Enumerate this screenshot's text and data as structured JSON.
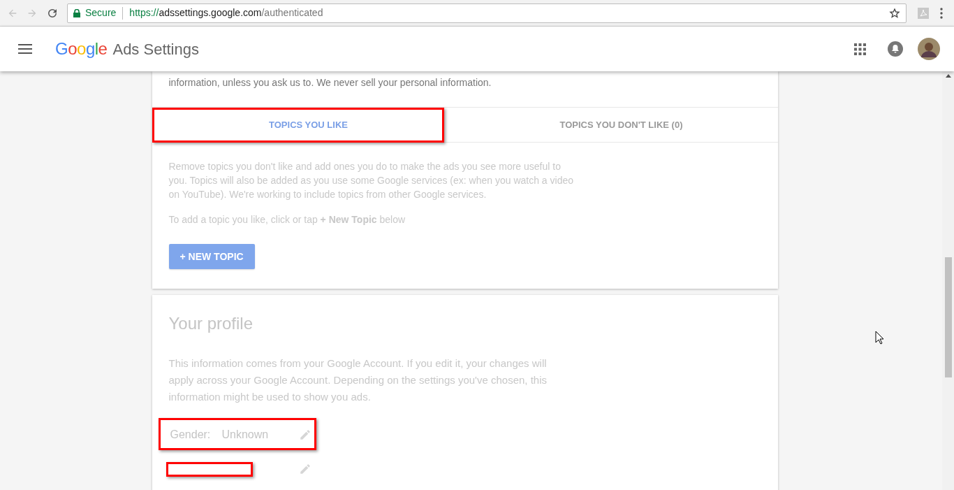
{
  "browser": {
    "secure_label": "Secure",
    "url_scheme": "https://",
    "url_host": "adssettings.google.com",
    "url_path": "/authenticated"
  },
  "header": {
    "logo_letters": [
      {
        "letter": "G",
        "color": "#4285f4"
      },
      {
        "letter": "o",
        "color": "#ea4335"
      },
      {
        "letter": "o",
        "color": "#fbbc05"
      },
      {
        "letter": "g",
        "color": "#4285f4"
      },
      {
        "letter": "l",
        "color": "#34a853"
      },
      {
        "letter": "e",
        "color": "#ea4335"
      }
    ],
    "title": "Ads Settings"
  },
  "intro_text": "information, unless you ask us to. We never sell your personal information.",
  "tabs": [
    {
      "label": "TOPICS YOU LIKE",
      "selected": true,
      "highlighted": true
    },
    {
      "label": "TOPICS YOU DON'T LIKE (0)",
      "selected": false,
      "highlighted": false
    }
  ],
  "topics": {
    "description": "Remove topics you don't like and add ones you do to make the ads you see more useful to you. Topics will also be added as you use some Google services (ex: when you watch a video on YouTube). We're working to include topics from other Google services.",
    "hint": "To add a topic you like, click or tap **+ New Topic** below",
    "button": "+ NEW TOPIC"
  },
  "profile": {
    "title": "Your profile",
    "description": "This information comes from your Google Account. If you edit it, your changes will apply across your Google Account. Depending on the settings you've chosen, this information might be used to show you ads.",
    "rows": [
      {
        "kind": "field",
        "label": "Gender:",
        "value": "Unknown",
        "highlighted": true
      },
      {
        "kind": "redacted",
        "highlighted": true
      }
    ]
  }
}
